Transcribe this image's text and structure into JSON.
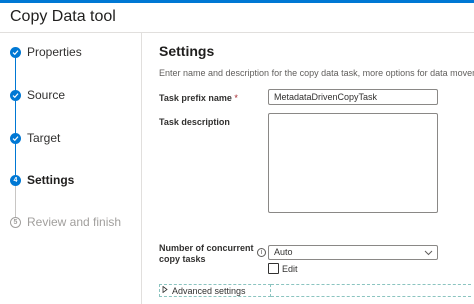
{
  "app": {
    "title": "Copy Data tool",
    "accent_color": "#0078d4"
  },
  "steps": [
    {
      "label": "Properties",
      "marker": "",
      "state": "done"
    },
    {
      "label": "Source",
      "marker": "",
      "state": "done"
    },
    {
      "label": "Target",
      "marker": "",
      "state": "done"
    },
    {
      "label": "Settings",
      "marker": "4",
      "state": "active"
    },
    {
      "label": "Review and finish",
      "marker": "5",
      "state": "pending"
    }
  ],
  "main": {
    "heading": "Settings",
    "description": "Enter name and description for the copy data task, more options for data movement",
    "task_prefix": {
      "label": "Task prefix name",
      "required_mark": "*",
      "value": "MetadataDrivenCopyTask"
    },
    "task_description": {
      "label": "Task description",
      "value": ""
    },
    "concurrent": {
      "label_line1": "Number of concurrent",
      "label_line2": "copy tasks",
      "info_icon": "i",
      "selected": "Auto"
    },
    "edit": {
      "label": "Edit",
      "checked": false
    },
    "advanced": {
      "label": "Advanced settings"
    }
  }
}
